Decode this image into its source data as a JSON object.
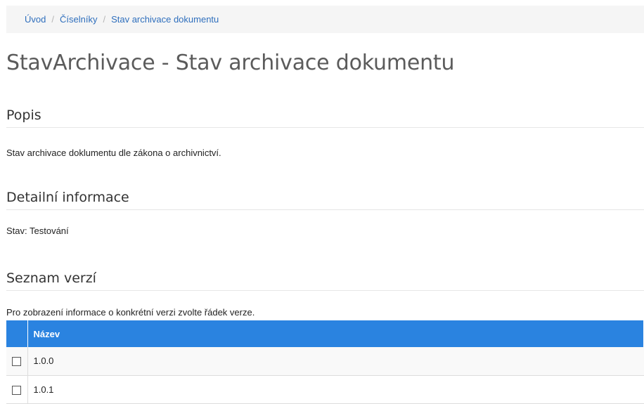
{
  "breadcrumb": {
    "items": [
      "Úvod",
      "Číselníky",
      "Stav archivace dokumentu"
    ],
    "separator": "/"
  },
  "page_title": "StavArchivace - Stav archivace dokumentu",
  "sections": {
    "popis": {
      "title": "Popis",
      "text": "Stav archivace doklumentu dle zákona o archivnictví."
    },
    "detail": {
      "title": "Detailní informace",
      "text": "Stav: Testování"
    },
    "verze": {
      "title": "Seznam verzí",
      "hint": "Pro zobrazení informace o konkrétní verzi zvolte řádek verze."
    }
  },
  "table": {
    "header": "Název",
    "rows": [
      "1.0.0",
      "1.0.1"
    ]
  },
  "colors": {
    "link": "#2f6fbd",
    "table_header": "#2a83e0"
  }
}
